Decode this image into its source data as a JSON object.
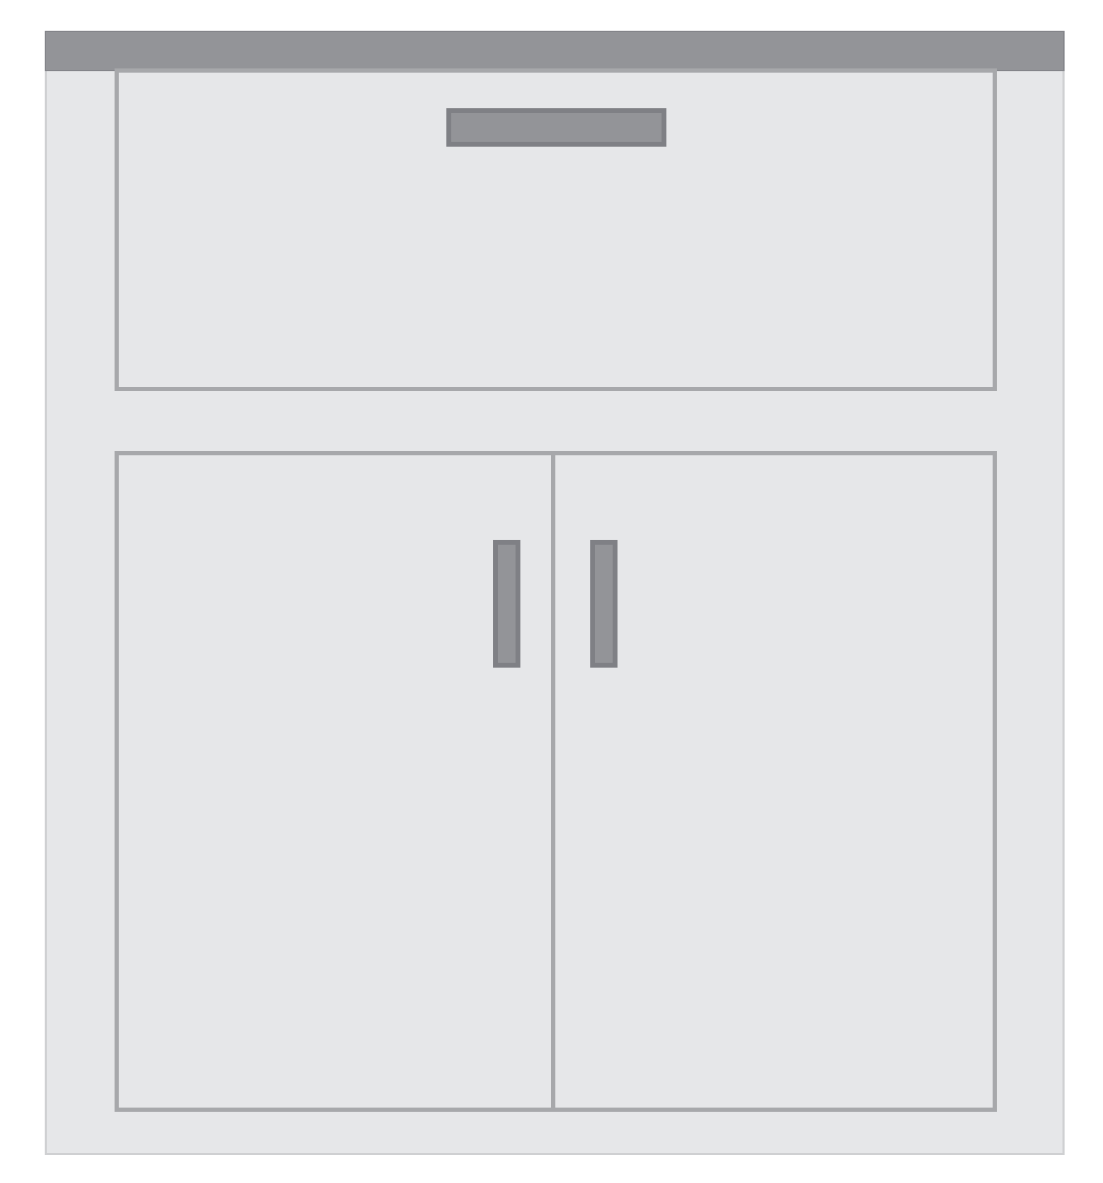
{
  "illustration": {
    "subject": "cabinet",
    "parts": {
      "countertop": "countertop",
      "drawer": "drawer",
      "left_door": "left-door",
      "right_door": "right-door"
    }
  },
  "colors": {
    "background": "#ffffff",
    "cabinet_fill": "#e6e7e9",
    "cabinet_outline": "#cfd0d2",
    "panel_outline": "#a7a8ab",
    "countertop": "#939498",
    "handle_fill": "#939498",
    "handle_outline": "#7f8085"
  }
}
